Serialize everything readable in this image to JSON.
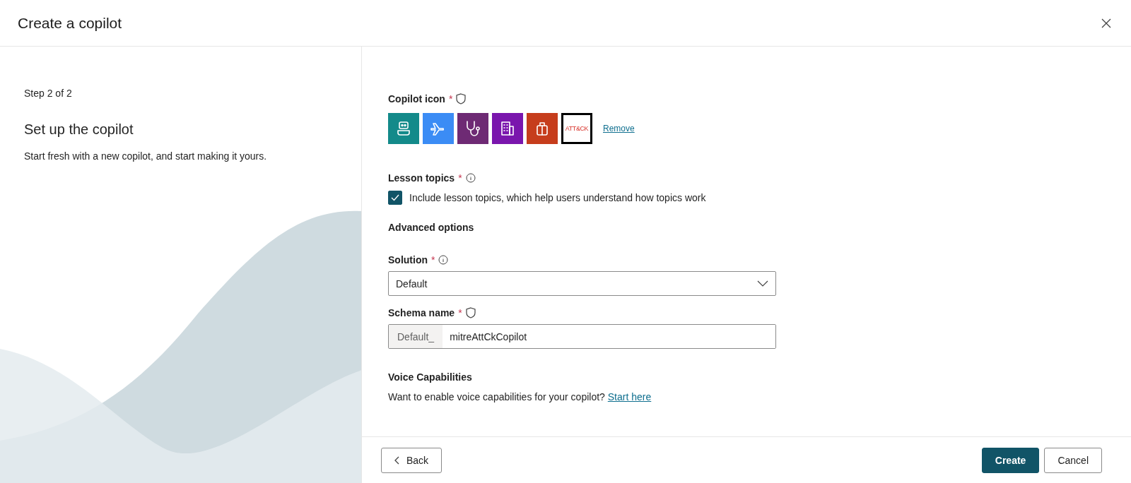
{
  "window": {
    "title": "Create a copilot"
  },
  "intro": {
    "step": "Step 2 of 2",
    "heading": "Set up the copilot",
    "description": "Start fresh with a new copilot, and start making it yours."
  },
  "copilot_icon": {
    "label": "Copilot icon",
    "required_mark": "*",
    "remove_link": "Remove",
    "icons": [
      {
        "kind": "robot",
        "color": "#138a8a",
        "selected": false
      },
      {
        "kind": "plane",
        "color": "#3b8cf5",
        "selected": false
      },
      {
        "kind": "stethoscope",
        "color": "#6e2a74",
        "selected": false
      },
      {
        "kind": "building",
        "color": "#7a16ad",
        "selected": false
      },
      {
        "kind": "gift",
        "color": "#c63d1c",
        "selected": false
      },
      {
        "kind": "text",
        "text": "ATT&CK",
        "color": "#ffffff",
        "selected": true
      }
    ]
  },
  "lesson_topics": {
    "label": "Lesson topics",
    "required_mark": "*",
    "checkbox_label": "Include lesson topics, which help users understand how topics work",
    "checked": true
  },
  "advanced_options": {
    "title": "Advanced options"
  },
  "solution": {
    "label": "Solution",
    "required_mark": "*",
    "value": "Default"
  },
  "schema_name": {
    "label": "Schema name",
    "required_mark": "*",
    "prefix": "Default_",
    "value": "mitreAttCkCopilot"
  },
  "voice": {
    "title": "Voice Capabilities",
    "text": "Want to enable voice capabilities for your copilot?",
    "link": "Start here"
  },
  "footer": {
    "back": "Back",
    "create": "Create",
    "cancel": "Cancel"
  }
}
